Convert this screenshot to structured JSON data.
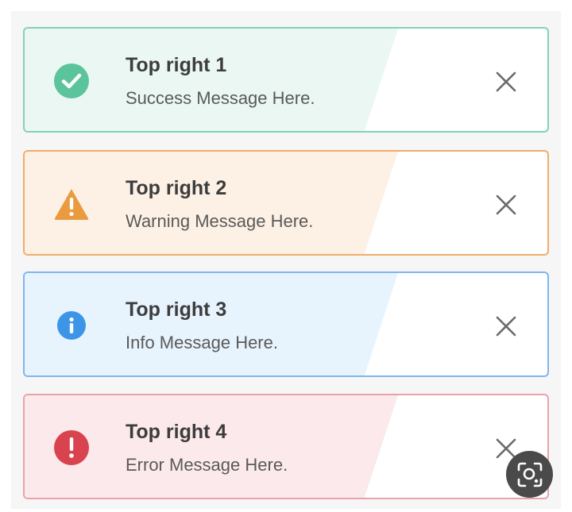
{
  "toasts": [
    {
      "title": "Top right 1",
      "message": "Success Message Here.",
      "type": "success",
      "icon": "check-circle-icon",
      "border": "#7fd3b6",
      "tint": "#eaf7f3",
      "icon_color": "#5cc49c"
    },
    {
      "title": "Top right 2",
      "message": "Warning Message Here.",
      "type": "warning",
      "icon": "warning-triangle-icon",
      "border": "#f0ad6a",
      "tint": "#fdf1e6",
      "icon_color": "#ea9a3f"
    },
    {
      "title": "Top right 3",
      "message": "Info Message Here.",
      "type": "info",
      "icon": "info-circle-icon",
      "border": "#7fb6ee",
      "tint": "#e7f3fd",
      "icon_color": "#3d95e8"
    },
    {
      "title": "Top right 4",
      "message": "Error Message Here.",
      "type": "error",
      "icon": "error-circle-icon",
      "border": "#e8a3aa",
      "tint": "#fbe9eb",
      "icon_color": "#d9434f"
    }
  ],
  "close_icon": "close-icon",
  "overlay_icon": "visual-search-lens-icon"
}
